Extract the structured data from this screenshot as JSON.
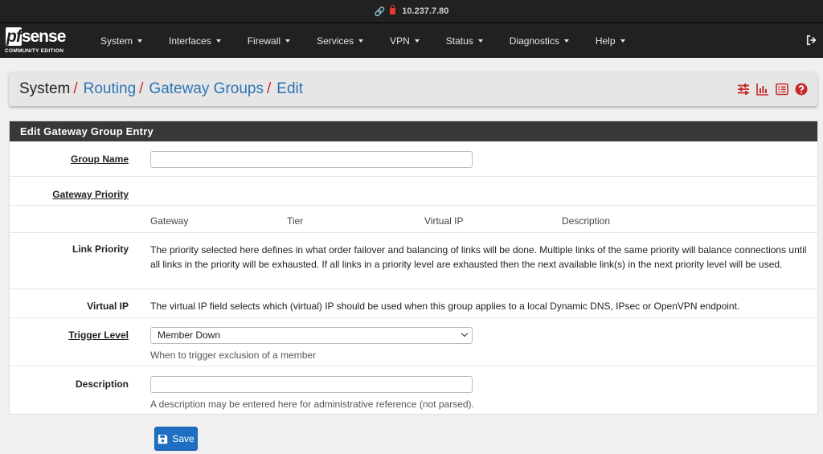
{
  "browser": {
    "url": "10.237.7.80"
  },
  "brand": {
    "logo_pf": "pf",
    "logo_sense": "sense",
    "edition": "COMMUNITY EDITION"
  },
  "nav": {
    "items": [
      {
        "label": "System"
      },
      {
        "label": "Interfaces"
      },
      {
        "label": "Firewall"
      },
      {
        "label": "Services"
      },
      {
        "label": "VPN"
      },
      {
        "label": "Status"
      },
      {
        "label": "Diagnostics"
      },
      {
        "label": "Help"
      }
    ]
  },
  "breadcrumb": {
    "root": "System",
    "items": [
      "Routing",
      "Gateway Groups",
      "Edit"
    ],
    "sep": "/"
  },
  "panel": {
    "title": "Edit Gateway Group Entry",
    "group_name": {
      "label": "Group Name",
      "value": ""
    },
    "gateway_priority": {
      "label": "Gateway Priority"
    },
    "columns": [
      "Gateway",
      "Tier",
      "Virtual IP",
      "Description"
    ],
    "link_priority": {
      "label": "Link Priority",
      "text": "The priority selected here defines in what order failover and balancing of links will be done. Multiple links of the same priority will balance connections until all links in the priority will be exhausted. If all links in a priority level are exhausted then the next available link(s) in the next priority level will be used."
    },
    "virtual_ip": {
      "label": "Virtual IP",
      "text": "The virtual IP field selects which (virtual) IP should be used when this group applies to a local Dynamic DNS, IPsec or OpenVPN endpoint."
    },
    "trigger_level": {
      "label": "Trigger Level",
      "selected": "Member Down",
      "help": "When to trigger exclusion of a member"
    },
    "description": {
      "label": "Description",
      "value": "",
      "help": "A description may be entered here for administrative reference (not parsed)."
    }
  },
  "actions": {
    "save_label": "Save"
  },
  "colors": {
    "accent": "#2d73b5",
    "danger": "#c62828",
    "navbar": "#212121",
    "button": "#1e6fc2"
  }
}
